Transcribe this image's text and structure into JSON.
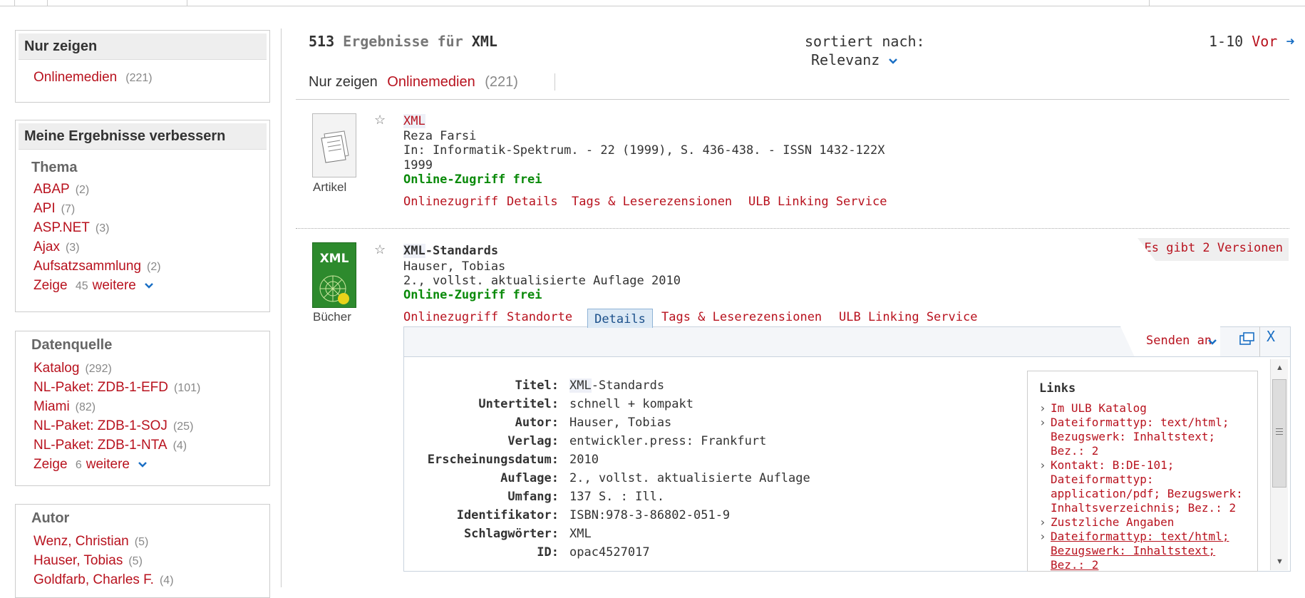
{
  "sidebar": {
    "nur_zeigen": {
      "title": "Nur zeigen",
      "items": [
        {
          "label": "Onlinemedien",
          "count": "(221)"
        }
      ]
    },
    "verbessern": {
      "title": "Meine Ergebnisse verbessern",
      "thema": {
        "title": "Thema",
        "items": [
          {
            "label": "ABAP",
            "count": "(2)"
          },
          {
            "label": "API",
            "count": "(7)"
          },
          {
            "label": "ASP.NET",
            "count": "(3)"
          },
          {
            "label": "Ajax",
            "count": "(3)"
          },
          {
            "label": "Aufsatzsammlung",
            "count": "(2)"
          }
        ],
        "more_prefix": "Zeige",
        "more_count": "45",
        "more_suffix": "weitere"
      }
    },
    "datenquelle": {
      "title": "Datenquelle",
      "items": [
        {
          "label": "Katalog",
          "count": "(292)"
        },
        {
          "label": "NL-Paket: ZDB-1-EFD",
          "count": "(101)"
        },
        {
          "label": "Miami",
          "count": "(82)"
        },
        {
          "label": "NL-Paket: ZDB-1-SOJ",
          "count": "(25)"
        },
        {
          "label": "NL-Paket: ZDB-1-NTA",
          "count": "(4)"
        }
      ],
      "more_prefix": "Zeige",
      "more_count": "6",
      "more_suffix": "weitere"
    },
    "autor": {
      "title": "Autor",
      "items": [
        {
          "label": "Wenz, Christian",
          "count": "(5)"
        },
        {
          "label": "Hauser, Tobias",
          "count": "(5)"
        },
        {
          "label": "Goldfarb, Charles F.",
          "count": "(4)"
        }
      ]
    }
  },
  "results_header": {
    "count": "513",
    "text": "Ergebnisse für",
    "query": "XML",
    "sort_label": "sortiert nach:",
    "sort_value": "Relevanz",
    "paging": "1-10",
    "next": "Vor"
  },
  "filter_bar": {
    "label": "Nur zeigen",
    "value": "Onlinemedien",
    "count": "(221)"
  },
  "results": [
    {
      "type": "Artikel",
      "title_hl": "XML",
      "title_rest": "",
      "author": "Reza Farsi",
      "source": "In: Informatik-Spektrum. - 22 (1999), S. 436-438. - ISSN 1432-122X",
      "year": "1999",
      "access": "Online-Zugriff frei",
      "links": [
        "Onlinezugriff",
        "Details",
        "Tags & Leserezensionen",
        "ULB Linking Service"
      ]
    },
    {
      "type": "Bücher",
      "title_hl": "XML",
      "title_rest": "-Standards",
      "author": "Hauser, Tobias",
      "edition": "2., vollst. aktualisierte Auflage 2010",
      "access": "Online-Zugriff frei",
      "versions": "Es gibt 2 Versionen",
      "cover_text": "XML",
      "links": [
        "Onlinezugriff",
        "Standorte",
        "Details",
        "Tags & Leserezensionen",
        "ULB Linking Service"
      ]
    }
  ],
  "details": {
    "send_to": "Senden an",
    "close": "X",
    "fields": [
      {
        "label": "Titel:",
        "value_hl": "XML",
        "value": "-Standards"
      },
      {
        "label": "Untertitel:",
        "value": "schnell + kompakt"
      },
      {
        "label": "Autor:",
        "value": "Hauser, Tobias",
        "link": true
      },
      {
        "label": "Verlag:",
        "value": "entwickler.press: Frankfurt"
      },
      {
        "label": "Erscheinungsdatum:",
        "value": "2010"
      },
      {
        "label": "Auflage:",
        "value": "2., vollst. aktualisierte Auflage"
      },
      {
        "label": "Umfang:",
        "value": "137 S. : Ill."
      },
      {
        "label": "Identifikator:",
        "value": "ISBN:978-3-86802-051-9"
      },
      {
        "label": "Schlagwörter:",
        "value": "XML",
        "link": true
      },
      {
        "label": "ID:",
        "value": "opac4527017"
      }
    ],
    "links_title": "Links",
    "links": [
      [
        "Im ULB Katalog"
      ],
      [
        "Dateiformattyp: text/html;",
        "Bezugswerk: Inhaltstext;",
        "Bez.: 2"
      ],
      [
        "Kontakt: B:DE-101;",
        "Dateiformattyp:",
        "application/pdf; Bezugswerk:",
        "Inhaltsverzeichnis; Bez.: 2"
      ],
      [
        "Zustzliche Angaben"
      ],
      [
        "Dateiformattyp: text/html;",
        "Bezugswerk: Inhaltstext;",
        "Bez.: 2"
      ]
    ]
  },
  "colors": {
    "link": "#b8121e",
    "access": "#0a8a0a",
    "accent": "#1a6fc4"
  }
}
